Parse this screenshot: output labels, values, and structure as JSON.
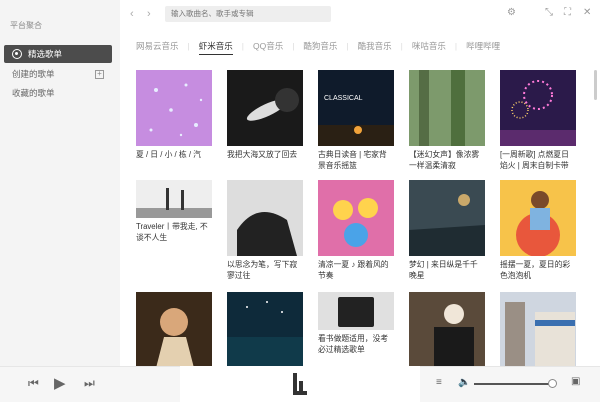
{
  "sidebar": {
    "section_title": "平台聚合",
    "items": [
      {
        "label": "精选歌单"
      },
      {
        "label": "创建的歌单"
      },
      {
        "label": "收藏的歌单"
      }
    ]
  },
  "topbar": {
    "search_placeholder": "输入歌曲名、歌手或专辑"
  },
  "tabs": [
    "网易云音乐",
    "虾米音乐",
    "QQ音乐",
    "酷狗音乐",
    "酷我音乐",
    "咪咕音乐",
    "哔哩哔哩"
  ],
  "active_tab": "虾米音乐",
  "playlists": [
    {
      "title": "夏 / 日 / 小 / 栋 / 汽"
    },
    {
      "title": "我把大海又放了回去"
    },
    {
      "title": "古典日读音 | 宅家背景音乐摇篮",
      "thumb_text": "CLASSICAL"
    },
    {
      "title": "【迷幻女声】像浓雾一样温柔清寂"
    },
    {
      "title": "[一周新歌] 点燃夏日焰火 | 周末自制卡带"
    },
    {
      "title": "Traveler丨带我走, 不谈不人生"
    },
    {
      "title": "以思念为笔，写下寂寥过往"
    },
    {
      "title": "清凉一夏 ♪ 跟着风的节奏"
    },
    {
      "title": "梦幻 | 来日纵是千千晚星"
    },
    {
      "title": "摇摆一夏，夏日的彩色泡泡机"
    },
    {
      "title": ""
    },
    {
      "title": ""
    },
    {
      "title": "看书做题适用，没考必过精选歌单"
    },
    {
      "title": ""
    },
    {
      "title": ""
    }
  ]
}
